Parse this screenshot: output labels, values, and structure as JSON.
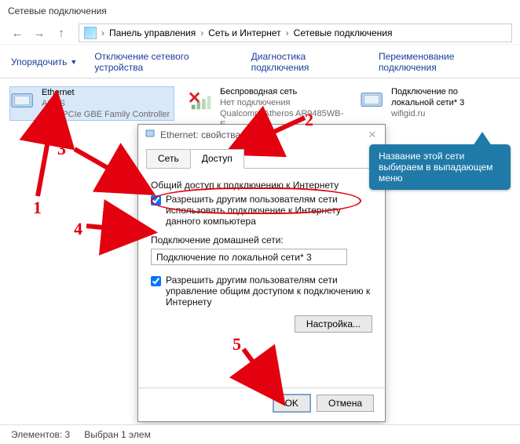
{
  "window": {
    "title": "Сетевые подключения"
  },
  "breadcrumb": {
    "root": "Панель управления",
    "mid": "Сеть и Интернет",
    "leaf": "Сетевые подключения"
  },
  "toolbar": {
    "organize": "Упорядочить",
    "disable": "Отключение сетевого устройства",
    "diag": "Диагностика подключения",
    "rename": "Переименование подключения"
  },
  "conn": [
    {
      "name": "Ethernet",
      "sub1": "ASUS",
      "sub2": "altek PCIe GBE Family Controller"
    },
    {
      "name": "Беспроводная сеть",
      "sub1": "Нет подключения",
      "sub2": "Qualcomm Atheros AR9485WB-E…"
    },
    {
      "name": "Подключение по локальной сети* 3",
      "sub1": "wifigid.ru",
      "sub2": ""
    }
  ],
  "dialog": {
    "title": "Ethernet: свойства",
    "tabs": {
      "a": "Сеть",
      "b": "Доступ"
    },
    "section_ics": "Общий доступ к подключению к Интернету",
    "cb_allow": "Разрешить другим пользователям сети использовать подключение к Интернету данного компьютера",
    "home_label": "Подключение домашней сети:",
    "home_value": "Подключение по локальной сети* 3",
    "cb_control": "Разрешить другим пользователям сети управление общим доступом к подключению к Интернету",
    "btn_settings": "Настройка...",
    "btn_ok": "OK",
    "btn_cancel": "Отмена"
  },
  "callout": {
    "text": "Название этой сети выбираем в выпадающем меню"
  },
  "status": {
    "count": "Элементов: 3",
    "sel": "Выбран 1 элем"
  },
  "annot": {
    "1": "1",
    "2": "2",
    "3": "3",
    "4": "4",
    "5": "5"
  }
}
